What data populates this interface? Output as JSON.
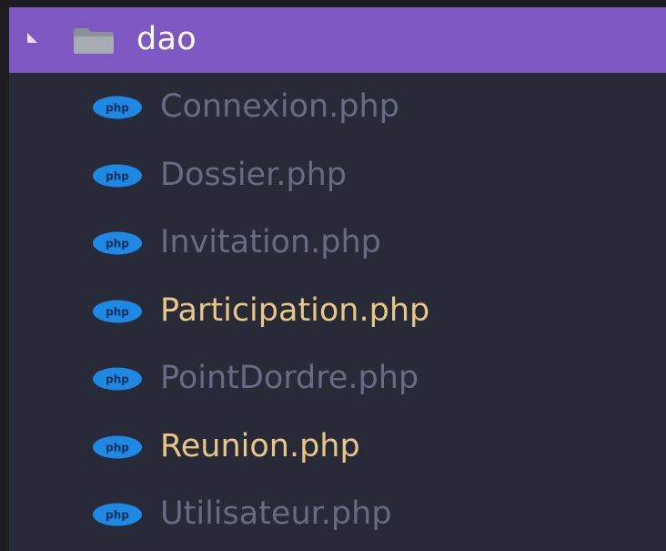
{
  "folder": {
    "name": "dao",
    "expanded": true,
    "icon": "folder-icon",
    "row_color": "#7e57c2"
  },
  "files": [
    {
      "name": "Connexion.php",
      "modified": false
    },
    {
      "name": "Dossier.php",
      "modified": false
    },
    {
      "name": "Invitation.php",
      "modified": false
    },
    {
      "name": "Participation.php",
      "modified": true
    },
    {
      "name": "PointDordre.php",
      "modified": false
    },
    {
      "name": "Reunion.php",
      "modified": true
    },
    {
      "name": "Utilisateur.php",
      "modified": false
    }
  ],
  "icons": {
    "file": "php-file-icon",
    "toggle": "caret-down-icon"
  },
  "colors": {
    "background": "#282a37",
    "dim_text": "#676c83",
    "modified_text": "#e7c786",
    "php_badge": "#1e88e5"
  }
}
